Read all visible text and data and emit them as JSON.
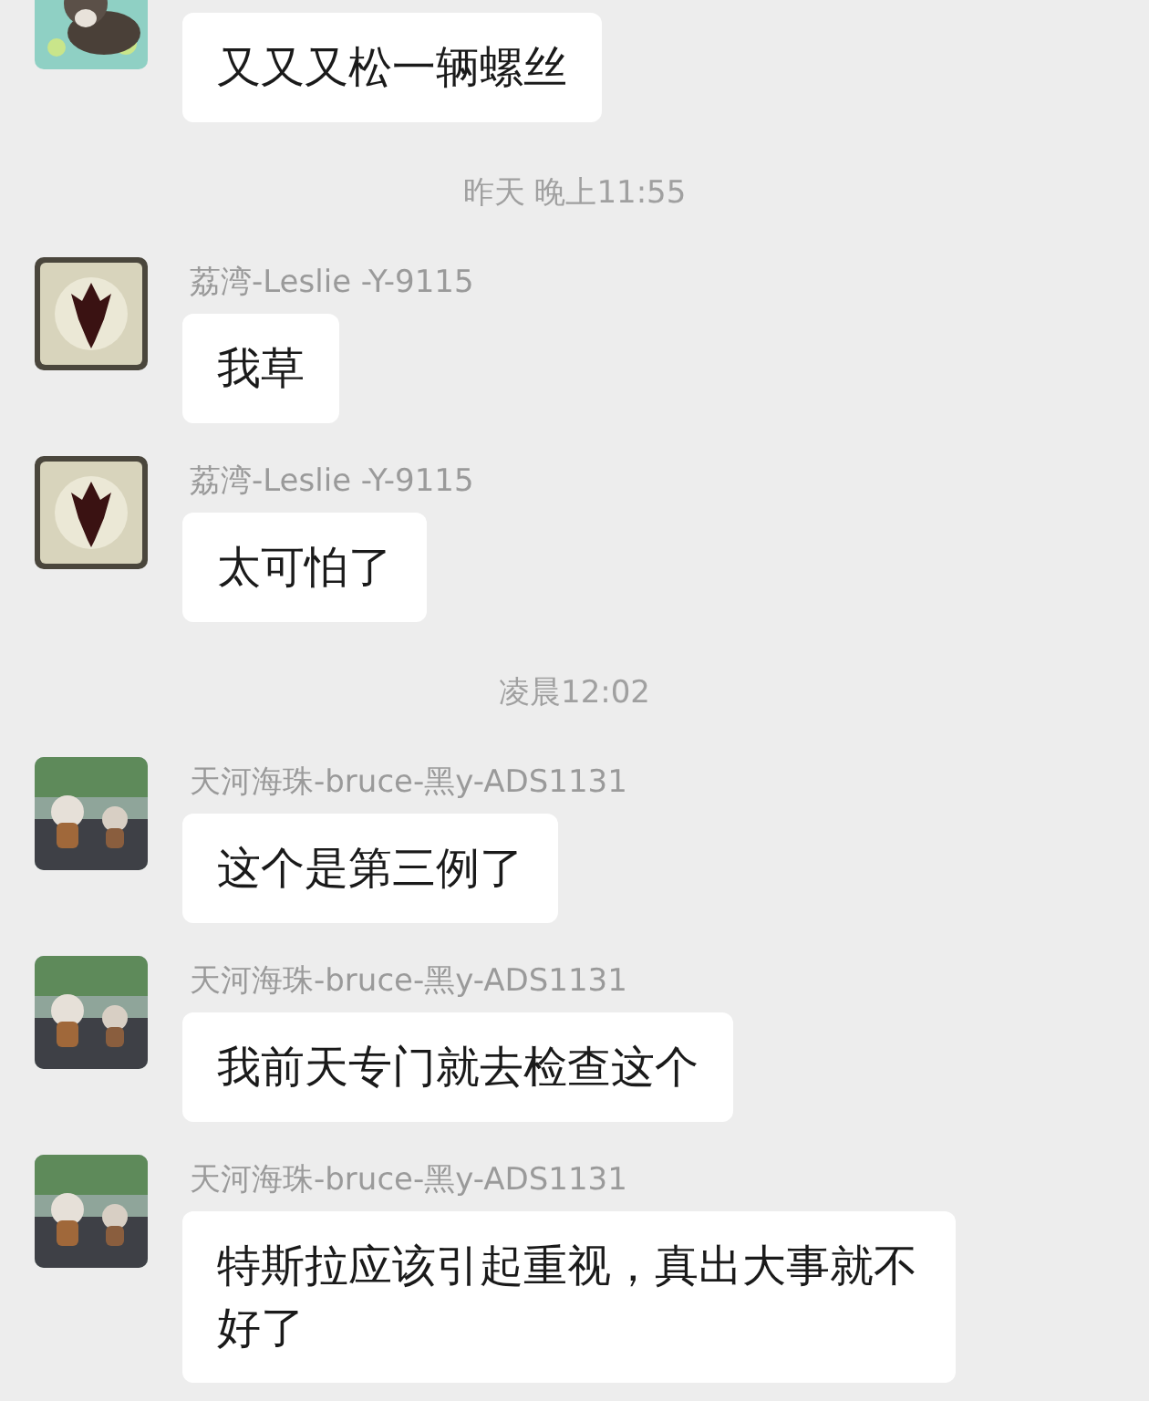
{
  "messages": [
    {
      "kind": "message",
      "text": "又又又松一辆螺丝"
    },
    {
      "kind": "time",
      "text": "昨天 晚上11:55"
    },
    {
      "kind": "message",
      "sender": "荔湾-Leslie -Y-9115",
      "text": "我草"
    },
    {
      "kind": "message",
      "sender": "荔湾-Leslie -Y-9115",
      "text": "太可怕了"
    },
    {
      "kind": "time",
      "text": "凌晨12:02"
    },
    {
      "kind": "message",
      "sender": "天河海珠-bruce-黑y-ADS1131",
      "text": "这个是第三例了"
    },
    {
      "kind": "message",
      "sender": "天河海珠-bruce-黑y-ADS1131",
      "text": "我前天专门就去检查这个"
    },
    {
      "kind": "message",
      "sender": "天河海珠-bruce-黑y-ADS1131",
      "text": "特斯拉应该引起重视，真出大事就不好了"
    }
  ]
}
